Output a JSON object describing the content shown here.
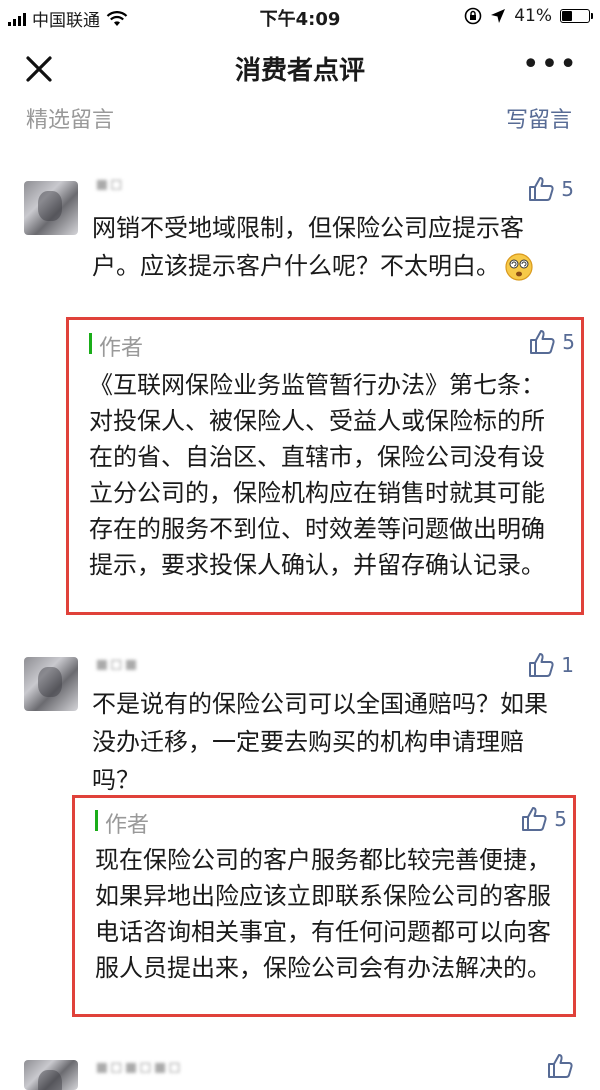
{
  "status_bar": {
    "carrier": "中国联通",
    "time": "下午4:09",
    "battery": "41%",
    "battery_level": 0.41
  },
  "nav": {
    "title": "消费者点评",
    "close_icon": "close-icon",
    "more_icon": "more-dots-icon",
    "more_label": "•••"
  },
  "section": {
    "title": "精选留言",
    "write_label": "写留言"
  },
  "comments": [
    {
      "likes": "5",
      "text": "网销不受地域限制，但保险公司应提示客户。应该提示客户什么呢？不太明白。",
      "emoji": "dizzy-face-emoji",
      "reply": {
        "label": "作者",
        "likes": "5",
        "text": "《互联网保险业务监管暂行办法》第七条：对投保人、被保险人、受益人或保险标的所在的省、自治区、直辖市，保险公司没有设立分公司的，保险机构应在销售时就其可能存在的服务不到位、时效差等问题做出明确提示，要求投保人确认，并留存确认记录。"
      }
    },
    {
      "likes": "1",
      "text": "不是说有的保险公司可以全国通赔吗？如果没办迁移，一定要去购买的机构申请理赔吗？",
      "reply": {
        "label": "作者",
        "likes": "5",
        "text": "现在保险公司的客户服务都比较完善便捷，如果异地出险应该立即联系保险公司的客服电话咨询相关事宜，有任何问题都可以向客服人员提出来，保险公司会有办法解决的。"
      }
    }
  ],
  "colors": {
    "link": "#576b95",
    "highlight_border": "#e0413a",
    "author_bar": "#1aad19"
  }
}
